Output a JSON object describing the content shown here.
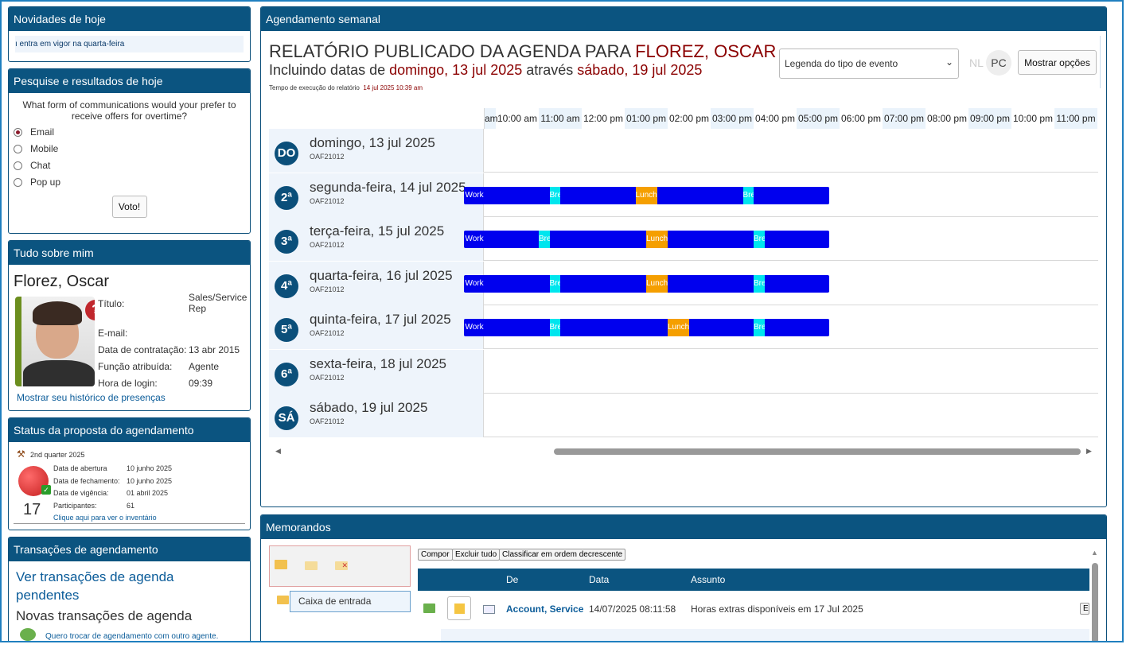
{
  "news": {
    "title": "Novidades de hoje",
    "text": "ı entra em vigor na quarta-feira"
  },
  "poll": {
    "title": "Pesquise e resultados de hoje",
    "question": "What form of communications would your prefer to receive offers for overtime?",
    "options": [
      "Email",
      "Mobile",
      "Chat",
      "Pop up"
    ],
    "selected": "Email",
    "vote_label": "Voto!"
  },
  "about": {
    "title": "Tudo sobre mim",
    "name": "Florez, Oscar",
    "fields": [
      {
        "label": "Título:",
        "value": "Sales/Service Rep"
      },
      {
        "label": "E-mail:",
        "value": ""
      },
      {
        "label": "Data de contratação:",
        "value": "13 abr 2015"
      },
      {
        "label": "Função atribuída:",
        "value": "Agente"
      },
      {
        "label": "Hora de login:",
        "value": "09:39"
      }
    ],
    "history_link": "Mostrar seu histórico de presenças",
    "help_glyph": "?"
  },
  "proposal": {
    "title": "Status da proposta do agendamento",
    "quarter": "2nd quarter 2025",
    "count": "17",
    "rows": [
      {
        "label": "Data de abertura",
        "value": "10 junho 2025"
      },
      {
        "label": "Data de fechamento:",
        "value": "10 junho 2025"
      },
      {
        "label": "Data de vigência:",
        "value": "01 abril 2025"
      },
      {
        "label": "Participantes:",
        "value": "61"
      }
    ],
    "inventory_link": "Clique aqui para ver o inventário"
  },
  "transactions": {
    "title": "Transações de agendamento",
    "pending_link": "Ver transações de agenda pendentes",
    "new_heading": "Novas transações de agenda",
    "swap_link": "Quero trocar de agendamento com outro agente."
  },
  "weekly": {
    "title": "Agendamento semanal",
    "report_prefix": "RELATÓRIO PUBLICADO DA AGENDA PARA ",
    "report_name": "FLOREZ, OSCAR",
    "incl_prefix": "Incluindo datas de ",
    "start": "domingo, 13 jul 2025",
    "through": " através ",
    "end": "sábado, 19 jul 2025",
    "exec_label": "Tempo de execução do relatório",
    "exec_time": "14 jul 2025 10:39 am",
    "legend_placeholder": "Legenda do tipo de evento",
    "nl": "NL",
    "pc": "PC",
    "options_button": "Mostrar opções",
    "hours": [
      "am",
      "10:00 am",
      "11:00 am",
      "12:00 pm",
      "01:00 pm",
      "02:00 pm",
      "03:00 pm",
      "04:00 pm",
      "05:00 pm",
      "06:00 pm",
      "07:00 pm",
      "08:00 pm",
      "09:00 pm",
      "10:00 pm",
      "11:00 pm"
    ],
    "days": [
      {
        "abbr": "DO",
        "name": "domingo, 13 jul 2025",
        "code": "OAF21012",
        "events": []
      },
      {
        "abbr": "2ª",
        "name": "segunda-feira, 14 jul 2025",
        "code": "OAF21012",
        "events": [
          {
            "type": "work",
            "label": "Work",
            "start": 9.25,
            "end": 17.75
          },
          {
            "type": "brk",
            "label": "Bre",
            "start": 11.25,
            "end": 11.5
          },
          {
            "type": "lun",
            "label": "Lunch",
            "start": 13.25,
            "end": 13.75
          },
          {
            "type": "brk",
            "label": "Bre",
            "start": 15.75,
            "end": 16.0
          }
        ]
      },
      {
        "abbr": "3ª",
        "name": "terça-feira, 15 jul 2025",
        "code": "OAF21012",
        "events": [
          {
            "type": "work",
            "label": "Work",
            "start": 9.25,
            "end": 17.75
          },
          {
            "type": "brk",
            "label": "Bre",
            "start": 11.0,
            "end": 11.25
          },
          {
            "type": "lun",
            "label": "Lunch",
            "start": 13.5,
            "end": 14.0
          },
          {
            "type": "brk",
            "label": "Bre",
            "start": 16.0,
            "end": 16.25
          }
        ]
      },
      {
        "abbr": "4ª",
        "name": "quarta-feira, 16 jul 2025",
        "code": "OAF21012",
        "events": [
          {
            "type": "work",
            "label": "Work",
            "start": 9.25,
            "end": 17.75
          },
          {
            "type": "brk",
            "label": "Bre",
            "start": 11.25,
            "end": 11.5
          },
          {
            "type": "lun",
            "label": "Lunch",
            "start": 13.5,
            "end": 14.0
          },
          {
            "type": "brk",
            "label": "Bre",
            "start": 16.0,
            "end": 16.25
          }
        ]
      },
      {
        "abbr": "5ª",
        "name": "quinta-feira, 17 jul 2025",
        "code": "OAF21012",
        "events": [
          {
            "type": "work",
            "label": "Work",
            "start": 9.25,
            "end": 17.75
          },
          {
            "type": "brk",
            "label": "Bre",
            "start": 11.25,
            "end": 11.5
          },
          {
            "type": "lun",
            "label": "Lunch",
            "start": 14.0,
            "end": 14.5
          },
          {
            "type": "brk",
            "label": "Bre",
            "start": 16.0,
            "end": 16.25
          }
        ]
      },
      {
        "abbr": "6ª",
        "name": "sexta-feira, 18 jul 2025",
        "code": "OAF21012",
        "events": []
      },
      {
        "abbr": "SÁ",
        "name": "sábado, 19 jul 2025",
        "code": "OAF21012",
        "events": []
      }
    ]
  },
  "memos": {
    "title": "Memorandos",
    "compose": "Compor",
    "delete_all": "Excluir tudo",
    "sort_desc": "Classificar em ordem decrescente",
    "inbox": "Caixa de entrada",
    "columns": [
      "De",
      "Data",
      "Assunto"
    ],
    "rows": [
      {
        "from": "Account, Service",
        "date": "14/07/2025 08:11:58",
        "subject": "Horas extras disponíveis em 17 Jul 2025",
        "action": "Ex"
      }
    ]
  },
  "colors": {
    "header": "#0b5480",
    "work": "#0000ee",
    "break": "#00e5ee",
    "lunch": "#f59f00",
    "accent_red": "#8b0000"
  }
}
